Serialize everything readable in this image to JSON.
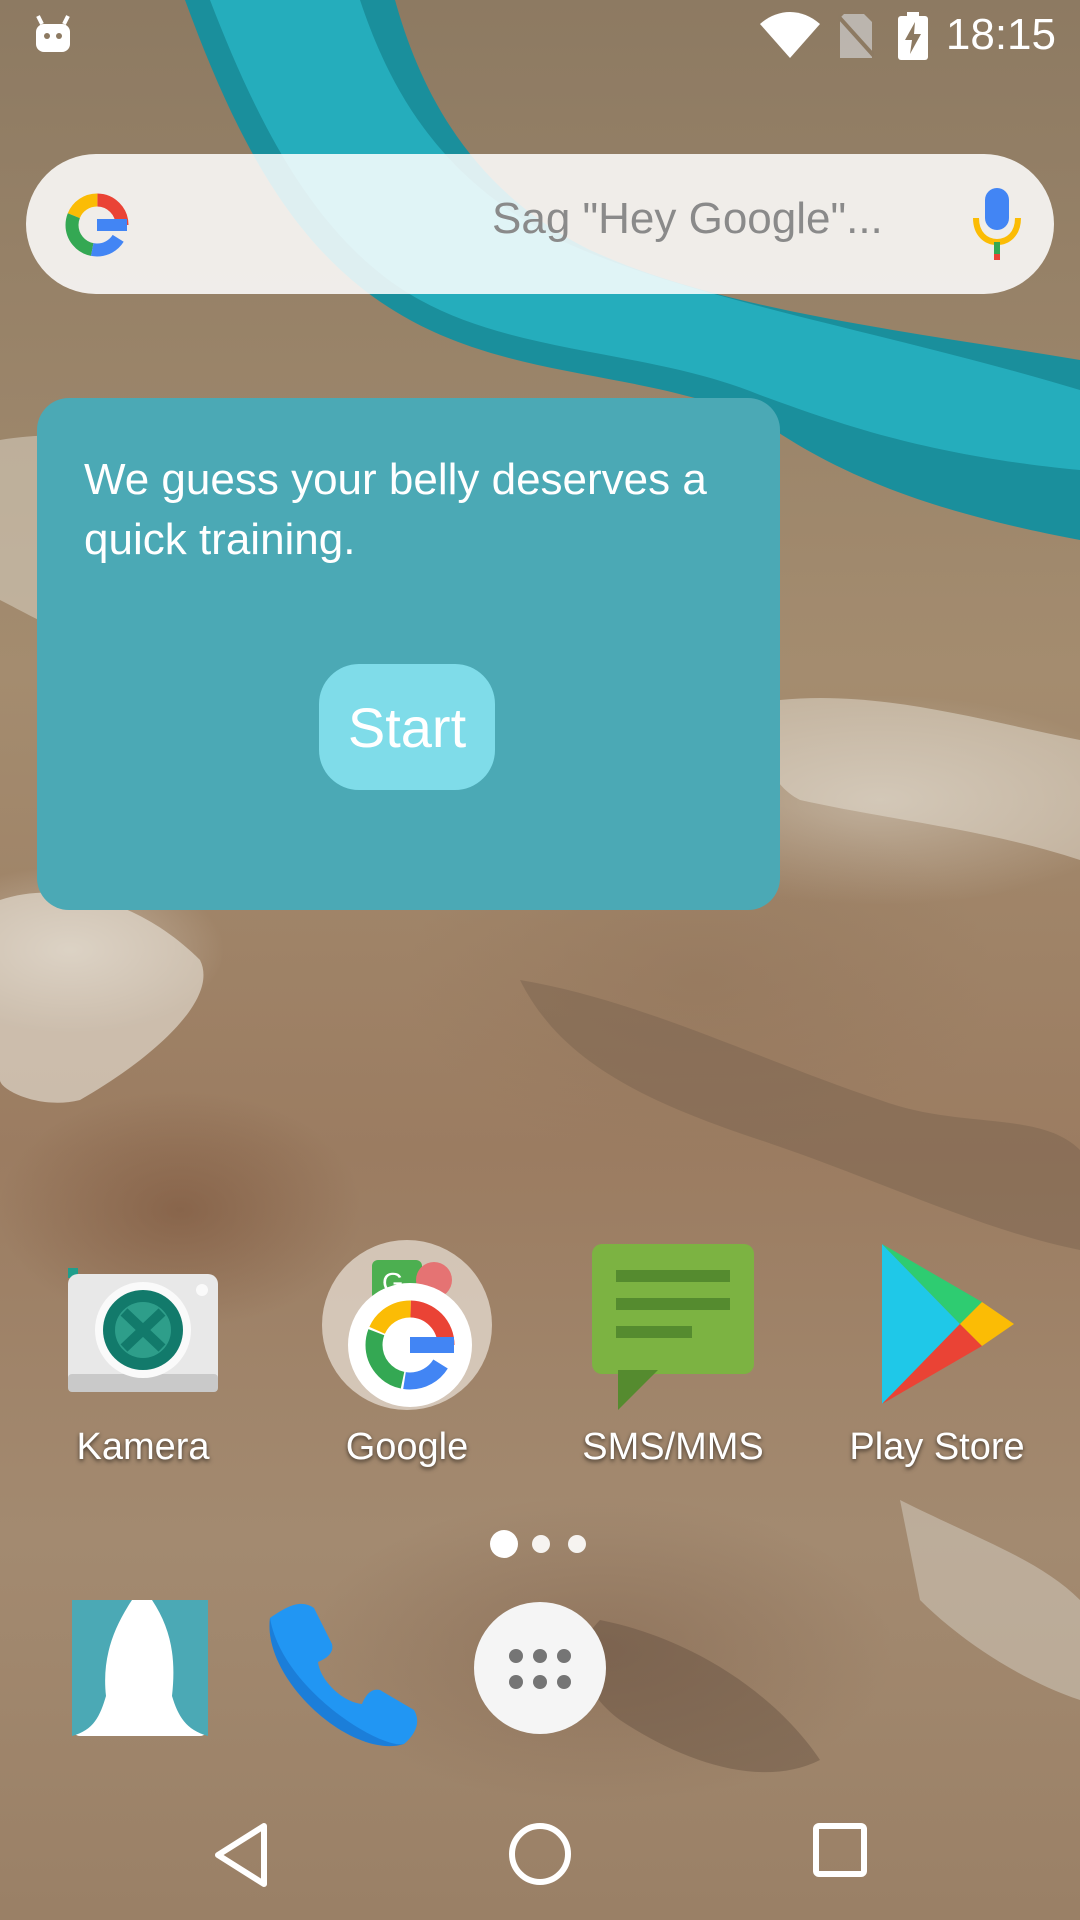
{
  "status_bar": {
    "time": "18:15",
    "icons": [
      "android-debug-icon",
      "wifi-icon",
      "no-sim-icon",
      "battery-charging-icon"
    ]
  },
  "search_bar": {
    "placeholder": "Sag \"Hey Google\"...",
    "logo_icon": "google-g-icon",
    "mic_icon": "mic-icon"
  },
  "widget": {
    "message": "We guess your belly deserves a quick training.",
    "start_label": "Start",
    "background": "#4ba9b5",
    "button_color": "#7fdce9"
  },
  "apps": [
    {
      "label": "Kamera",
      "icon": "camera-icon"
    },
    {
      "label": "Google",
      "icon": "google-folder-icon"
    },
    {
      "label": "SMS/MMS",
      "icon": "sms-icon"
    },
    {
      "label": "Play Store",
      "icon": "play-store-icon"
    }
  ],
  "page_indicator": {
    "pages": 3,
    "current": 1
  },
  "dock": [
    {
      "icon": "fitness-app-icon"
    },
    {
      "icon": "phone-icon"
    },
    {
      "icon": "app-drawer-icon"
    }
  ],
  "nav_bar": [
    "back-icon",
    "home-icon",
    "recents-icon"
  ]
}
